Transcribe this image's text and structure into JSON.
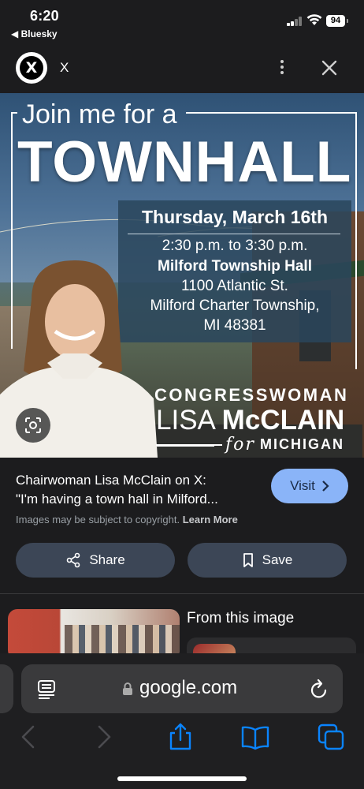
{
  "status_bar": {
    "time": "6:20",
    "back_app": "◀ Bluesky",
    "battery": "94"
  },
  "header": {
    "title": "X",
    "logo_letter": "X"
  },
  "poster": {
    "join_line": "Join me for a",
    "headline": "TOWNHALL",
    "date": "Thursday, March 16th",
    "time": "2:30 p.m. to 3:30 p.m.",
    "venue": "Milford Township Hall",
    "address1": "1100 Atlantic St.",
    "address2": "Milford Charter Township,",
    "address3": "MI 48381",
    "title_word": "CONGRESSWOMAN",
    "first_name": "LISA ",
    "last_name": "McCLAIN",
    "for_word": "for",
    "state": "MICHIGAN"
  },
  "result": {
    "title_line1": "Chairwoman Lisa McClain on X:",
    "title_line2": "\"I'm having a town hall in Milford...",
    "visit_label": "Visit",
    "copyright_text": "Images may be subject to copyright.",
    "learn_more": "Learn More",
    "share_label": "Share",
    "save_label": "Save"
  },
  "related": {
    "heading": "From this image"
  },
  "safari": {
    "url": "google.com"
  },
  "colors": {
    "accent_blue": "#8ab4f8",
    "button_bg": "#3c4656",
    "ios_blue": "#0a84ff"
  }
}
